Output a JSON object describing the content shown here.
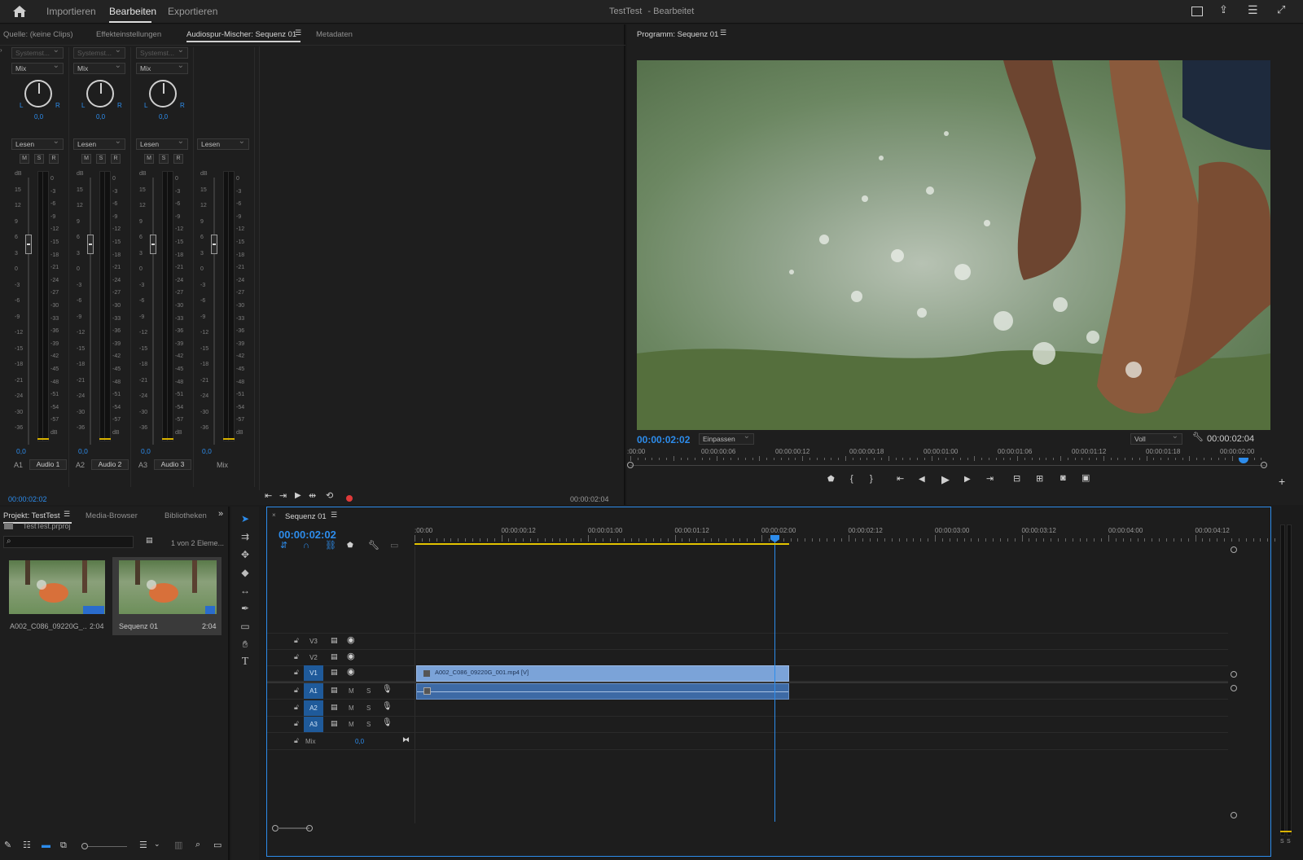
{
  "topbar": {
    "nav": [
      "Importieren",
      "Bearbeiten",
      "Exportieren"
    ],
    "title": "TestTest",
    "title_status": "- Bearbeitet"
  },
  "source_panel": {
    "tabs": [
      "Quelle: (keine Clips)",
      "Effekteinstellungen",
      "Audiospur-Mischer: Sequenz 01",
      "Metadaten"
    ],
    "footer_left": "00:00:02:02",
    "footer_right": "00:00:02:04"
  },
  "mixer": {
    "channels": [
      {
        "route": "Systemst...",
        "mode": "Mix",
        "pan": "0,0",
        "read": "Lesen",
        "level": "0,0",
        "id": "A1",
        "name": "Audio 1"
      },
      {
        "route": "Systemst...",
        "mode": "Mix",
        "pan": "0,0",
        "read": "Lesen",
        "level": "0,0",
        "id": "A2",
        "name": "Audio 2"
      },
      {
        "route": "Systemst...",
        "mode": "Mix",
        "pan": "0,0",
        "read": "Lesen",
        "level": "0,0",
        "id": "A3",
        "name": "Audio 3"
      },
      {
        "read": "Lesen",
        "level": "0,0",
        "name": "Mix"
      }
    ],
    "msr": [
      "M",
      "S",
      "R"
    ],
    "pan_l": "L",
    "pan_r": "R",
    "fader_scale": [
      "dB",
      "15",
      "12",
      "9",
      "6",
      "3",
      "0",
      "-3",
      "-6",
      "-9",
      "-12",
      "-15",
      "-18",
      "-21",
      "-24",
      "-30",
      "-36"
    ],
    "meter_scale": [
      "0",
      "-3",
      "-6",
      "-9",
      "-12",
      "-15",
      "-18",
      "-21",
      "-24",
      "-27",
      "-30",
      "-33",
      "-36",
      "-39",
      "-42",
      "-45",
      "-48",
      "-51",
      "-54",
      "-57",
      "dB"
    ]
  },
  "program": {
    "tab": "Programm: Sequenz 01",
    "timecode": "00:00:02:02",
    "fit": "Einpassen",
    "quality": "Voll",
    "duration": "00:00:02:04",
    "ruler": [
      ":00:00",
      "00:00:00:06",
      "00:00:00:12",
      "00:00:00:18",
      "00:00:01:00",
      "00:00:01:06",
      "00:00:01:12",
      "00:00:01:18",
      "00:00:02:00"
    ],
    "playhead_fraction": 0.97
  },
  "project": {
    "tabs": [
      "Projekt: TestTest",
      "Media-Browser",
      "Bibliotheken"
    ],
    "file": "TestTest.prproj",
    "count": "1 von 2 Eleme...",
    "items": [
      {
        "name": "A002_C086_09220G_...",
        "dur": "2:04"
      },
      {
        "name": "Sequenz 01",
        "dur": "2:04"
      }
    ]
  },
  "timeline": {
    "tab": "Sequenz 01",
    "timecode": "00:00:02:02",
    "ruler": [
      ":00:00",
      "00:00:00:12",
      "00:00:01:00",
      "00:00:01:12",
      "00:00:02:00",
      "00:00:02:12",
      "00:00:03:00",
      "00:00:03:12",
      "00:00:04:00",
      "00:00:04:12"
    ],
    "tracks_video": [
      "V3",
      "V2",
      "V1"
    ],
    "tracks_audio": [
      "A1",
      "A2",
      "A3"
    ],
    "mix_label": "Mix",
    "mix_value": "0,0",
    "clip_name": "A002_C086_09220G_001.mp4 [V]",
    "m": "M",
    "s": "S"
  },
  "side_meter": {
    "labels": [
      "S",
      "S"
    ]
  },
  "colors": {
    "accent": "#2d8ceb",
    "clip_video": "#7ba3d8",
    "clip_audio": "#3d6aa5",
    "record": "#e03a3a",
    "playhead": "#2d8ceb"
  }
}
